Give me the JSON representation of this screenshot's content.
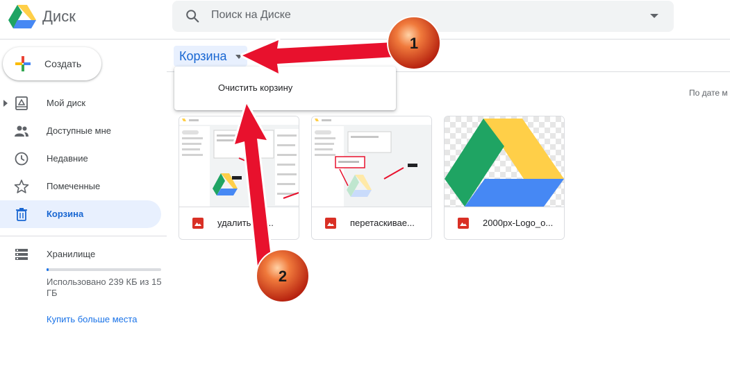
{
  "header": {
    "app_name": "Диск",
    "search_placeholder": "Поиск на Диске"
  },
  "sidebar": {
    "create_label": "Создать",
    "items": [
      {
        "label": "Мой диск",
        "icon": "my-drive-icon"
      },
      {
        "label": "Доступные мне",
        "icon": "shared-people-icon"
      },
      {
        "label": "Недавние",
        "icon": "clock-icon"
      },
      {
        "label": "Помеченные",
        "icon": "star-icon"
      },
      {
        "label": "Корзина",
        "icon": "trash-icon",
        "active": true
      }
    ],
    "storage": {
      "label": "Хранилище",
      "used_text": "Использовано 239 КБ из 15 ГБ",
      "used_fraction": 0.02,
      "buy_label": "Купить больше места"
    }
  },
  "main": {
    "breadcrumb": "Корзина",
    "menu": {
      "items": [
        "Очистить корзину"
      ]
    },
    "sort_label": "По дате м",
    "files": [
      {
        "name": "удалить фа...",
        "type": "image"
      },
      {
        "name": "перетаскиваe...",
        "type": "image"
      },
      {
        "name": "2000px-Logo_o...",
        "type": "image"
      }
    ]
  },
  "annotations": {
    "marker_1": "1",
    "marker_2": "2"
  },
  "colors": {
    "accent": "#1a73e8",
    "active_bg": "#e8f0fe",
    "arrow_red": "#e8112d",
    "marker_orange": "#e4542a",
    "drive_green": "#1fa463",
    "drive_yellow": "#ffd04b",
    "drive_blue": "#4688f4"
  }
}
